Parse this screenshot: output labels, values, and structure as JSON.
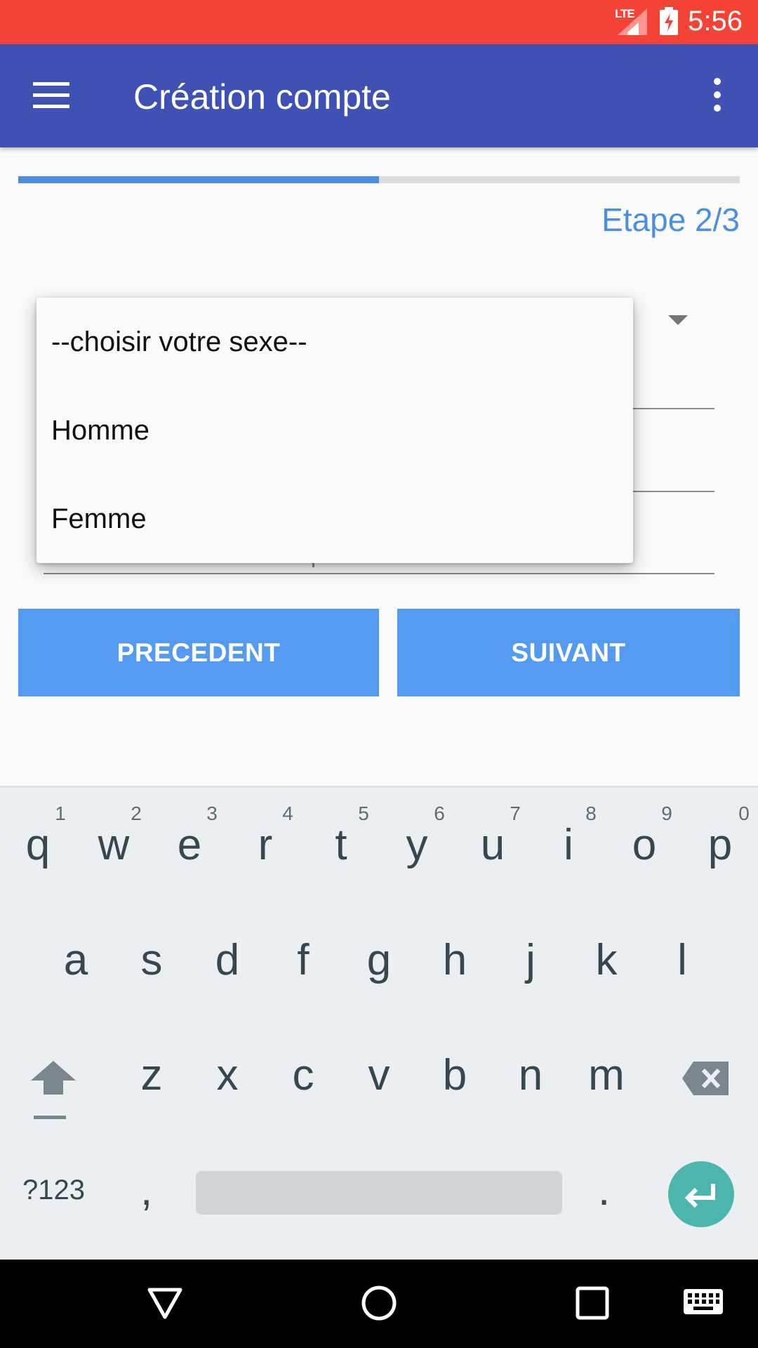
{
  "status_bar": {
    "network_label": "LTE",
    "time": "5:56",
    "background_color": "#f44336"
  },
  "app_bar": {
    "title": "Création compte",
    "menu_icon": "hamburger-menu-icon",
    "overflow_icon": "more-vert-icon",
    "background_color": "#3f51b5"
  },
  "progress": {
    "fraction": 0.5,
    "step_label": "Etape 2/3",
    "accent_color": "#4a90e2"
  },
  "gender_dropdown": {
    "options": [
      "--choisir votre sexe--",
      "Homme",
      "Femme"
    ]
  },
  "buttons": {
    "previous_label": "PRECEDENT",
    "next_label": "SUIVANT",
    "color": "#539bf0"
  },
  "keyboard": {
    "row1": [
      "q",
      "w",
      "e",
      "r",
      "t",
      "y",
      "u",
      "i",
      "o",
      "p"
    ],
    "row1_hints": [
      "1",
      "2",
      "3",
      "4",
      "5",
      "6",
      "7",
      "8",
      "9",
      "0"
    ],
    "row2": [
      "a",
      "s",
      "d",
      "f",
      "g",
      "h",
      "j",
      "k",
      "l"
    ],
    "row3": [
      "z",
      "x",
      "c",
      "v",
      "b",
      "n",
      "m"
    ],
    "symbols_label": "?123",
    "comma_label": ",",
    "period_label": ".",
    "enter_color": "#4db6ac"
  },
  "nav_bar": {
    "icons": [
      "back-triangle-icon",
      "home-circle-icon",
      "recents-square-icon",
      "keyboard-switch-icon"
    ]
  }
}
